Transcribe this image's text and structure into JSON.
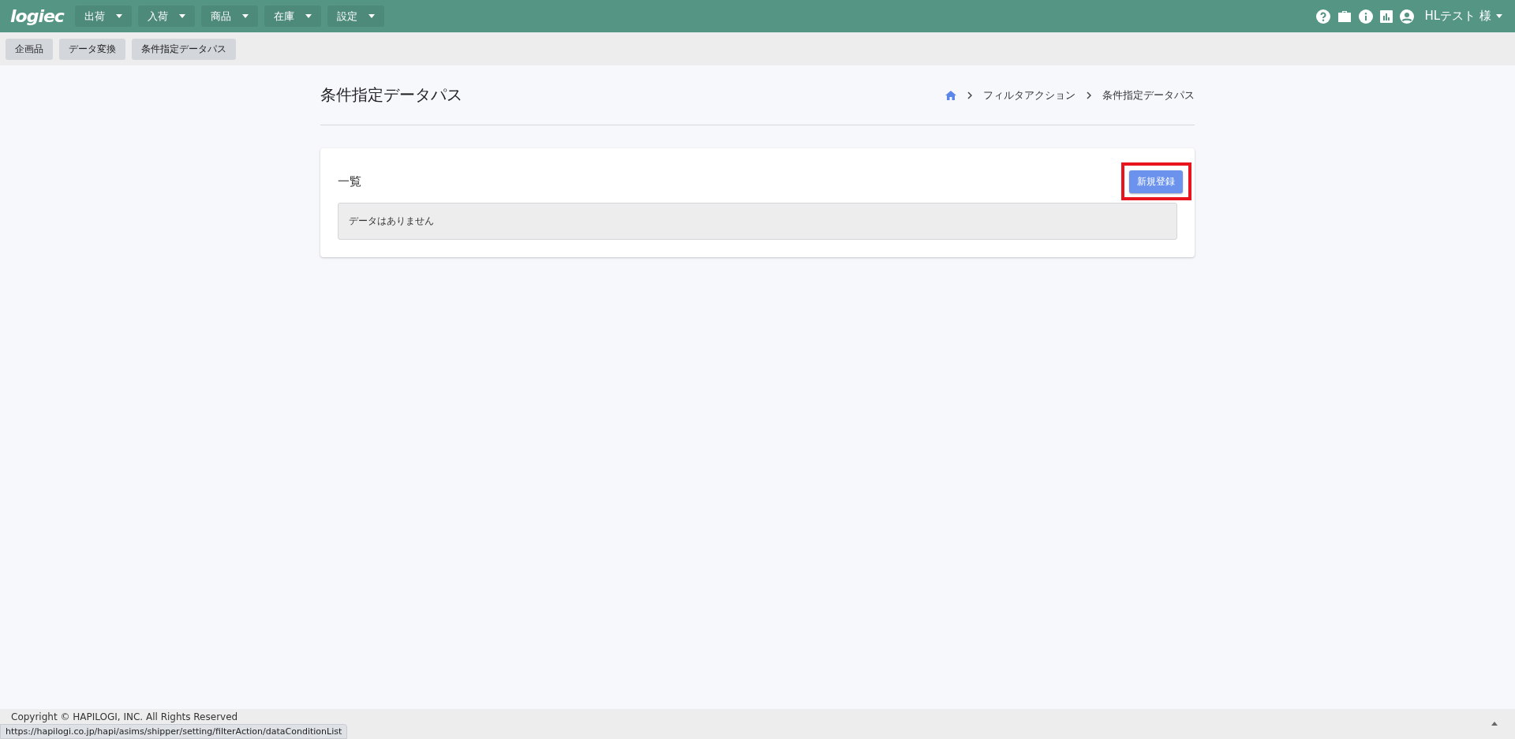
{
  "topbar": {
    "logo": "logiec",
    "menus": [
      {
        "label": "出荷"
      },
      {
        "label": "入荷"
      },
      {
        "label": "商品"
      },
      {
        "label": "在庫"
      },
      {
        "label": "設定"
      }
    ],
    "user": "HLテスト 様"
  },
  "quick_tabs": [
    {
      "label": "企画品"
    },
    {
      "label": "データ変換"
    },
    {
      "label": "条件指定データパス"
    }
  ],
  "page": {
    "title": "条件指定データパス",
    "breadcrumb": [
      "フィルタアクション",
      "条件指定データパス"
    ]
  },
  "card": {
    "title": "一覧",
    "new_button": {
      "label": "新規登録",
      "highlighted": true
    },
    "empty_message": "データはありません"
  },
  "footer": {
    "copyright": "Copyright © HAPILOGI, INC. All Rights Reserved"
  },
  "status_url": "https://hapilogi.co.jp/hapi/asims/shipper/setting/filterAction/dataConditionList"
}
